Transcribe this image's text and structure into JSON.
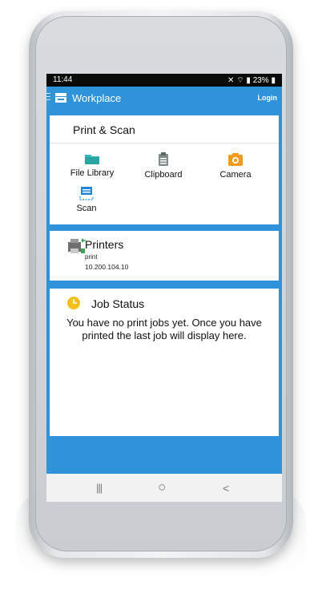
{
  "status": {
    "time": "11:44",
    "battery": "23%"
  },
  "appbar": {
    "title": "Workplace",
    "login": "Login"
  },
  "print_scan": {
    "heading": "Print & Scan",
    "tiles": [
      {
        "label": "File Library",
        "icon": "folder-icon",
        "color": "#2fb8b5"
      },
      {
        "label": "Clipboard",
        "icon": "clipboard-icon",
        "color": "#7f8b86"
      },
      {
        "label": "Camera",
        "icon": "camera-icon",
        "color": "#f39b1a"
      },
      {
        "label": "Scan",
        "icon": "scan-icon",
        "color": "#1e87d8"
      }
    ]
  },
  "printers": {
    "title": "Printers",
    "name": "print",
    "ip": "10.200.104.10"
  },
  "job_status": {
    "title": "Job Status",
    "message": "You have no print jobs yet. Once you have printed the last job will display here."
  },
  "nav": {
    "recents": "|||",
    "home": "○",
    "back": "<"
  },
  "colors": {
    "primary": "#2e93d8",
    "clock_icon": "#f3c019"
  }
}
